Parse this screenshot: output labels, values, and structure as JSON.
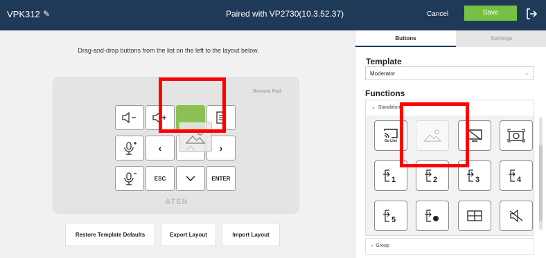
{
  "header": {
    "device_name": "VPK312",
    "paired_text": "Paired with VP2730(10.3.52.37)",
    "cancel_label": "Cancel",
    "save_label": "Save"
  },
  "editor": {
    "instruction": "Drag-and-drop buttons from the list on the left to the layout below.",
    "pad_label": "Remote Pad",
    "pad_logo": "ATEN",
    "keys": {
      "esc": "ESC",
      "enter": "ENTER"
    },
    "footer_buttons": [
      "Restore Template Defaults",
      "Export Layout",
      "Import Layout"
    ]
  },
  "sidebar": {
    "tabs": [
      "Buttons",
      "Settings"
    ],
    "template_heading": "Template",
    "template_value": "Moderator",
    "functions_heading": "Functions",
    "standalone_label": "Standalone",
    "go_live_label": "Go Live",
    "group_label": "Group"
  },
  "colors": {
    "header_bg": "#1f3a58",
    "save_green": "#76c043",
    "key_green": "#8cc152",
    "highlight_red": "#ff0000"
  }
}
